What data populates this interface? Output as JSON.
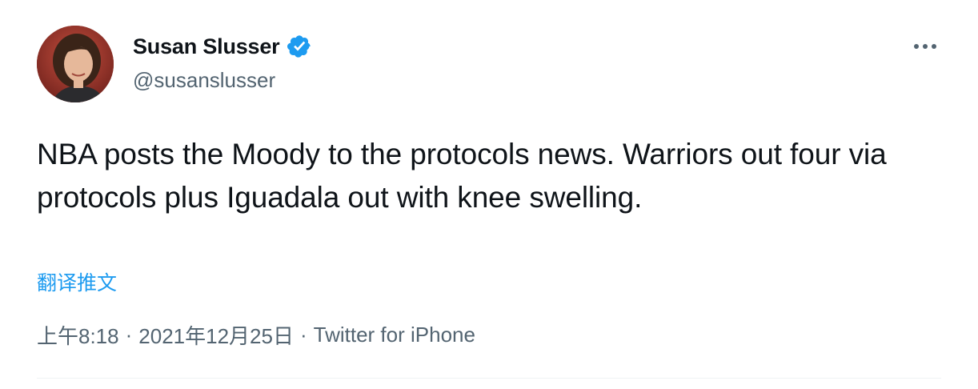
{
  "tweet": {
    "author": {
      "display_name": "Susan Slusser",
      "handle": "@susanslusser",
      "verified": true
    },
    "text": "NBA posts the Moody to the protocols news. Warriors out four via protocols plus Iguadala out with knee swelling.",
    "translate_label": "翻译推文",
    "time": "上午8:18",
    "separator": "·",
    "date": "2021年12月25日",
    "source": "Twitter for iPhone"
  },
  "icons": {
    "verified": "verified-badge-icon",
    "more": "more-options-icon"
  },
  "colors": {
    "text_primary": "#0f1419",
    "text_secondary": "#536471",
    "link": "#1d9bf0",
    "verified_badge": "#1d9bf0",
    "divider": "#eff3f4"
  }
}
